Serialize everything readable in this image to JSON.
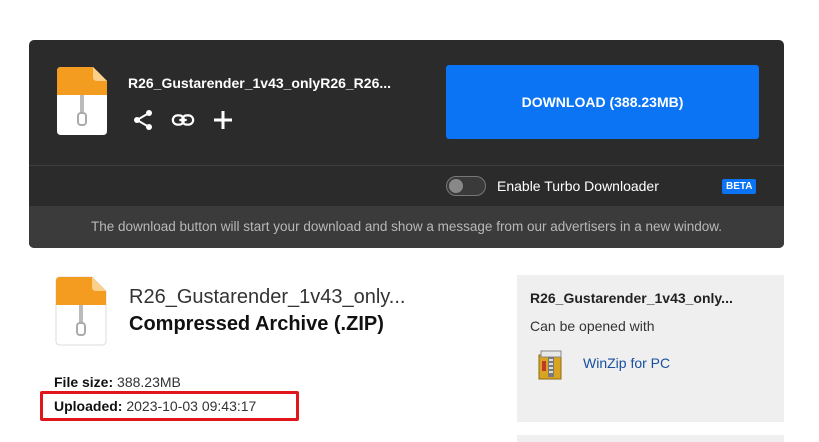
{
  "card": {
    "filename": "R26_Gustarender_1v43_onlyR26_R26...",
    "download_label": "DOWNLOAD (388.23MB)",
    "turbo_label": "Enable Turbo Downloader",
    "beta_badge": "BETA",
    "turbo_enabled": false,
    "notice": "The download button will start your download and show a message from our advertisers in a new window.",
    "actions": [
      "share-icon",
      "link-icon",
      "plus-icon"
    ]
  },
  "file": {
    "name": "R26_Gustarender_1v43_only...",
    "type": "Compressed Archive (.ZIP)",
    "size_label": "File size:",
    "size_value": "388.23MB",
    "uploaded_label": "Uploaded:",
    "uploaded_value": "2023-10-03 09:43:17"
  },
  "side": {
    "title": "R26_Gustarender_1v43_only...",
    "subtitle": "Can be opened with",
    "app_name": "WinZip for PC"
  },
  "colors": {
    "accent": "#0a74f5",
    "highlight": "#e0161b",
    "zip_orange": "#f39c1f"
  }
}
